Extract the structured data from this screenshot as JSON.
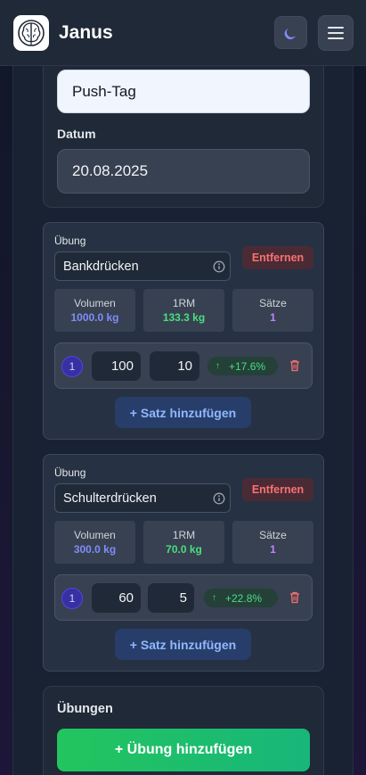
{
  "header": {
    "title": "Janus",
    "logo_icon": "brain-icon",
    "theme_icon": "moon-icon",
    "menu_icon": "hamburger-menu-icon"
  },
  "workout": {
    "name_value": "Push-Tag",
    "date_label": "Datum",
    "date_value": "20.08.2025"
  },
  "exercises": [
    {
      "label": "Übung",
      "name": "Bankdrücken",
      "remove_label": "Entfernen",
      "stats": {
        "volume_label": "Volumen",
        "volume_value": "1000.0 kg",
        "orm_label": "1RM",
        "orm_value": "133.3 kg",
        "sets_label": "Sätze",
        "sets_value": "1"
      },
      "sets": [
        {
          "number": "1",
          "weight": "100",
          "reps": "10",
          "change": "+17.6%"
        }
      ],
      "add_set_label": "+ Satz hinzufügen"
    },
    {
      "label": "Übung",
      "name": "Schulterdrücken",
      "remove_label": "Entfernen",
      "stats": {
        "volume_label": "Volumen",
        "volume_value": "300.0 kg",
        "orm_label": "1RM",
        "orm_value": "70.0 kg",
        "sets_label": "Sätze",
        "sets_value": "1"
      },
      "sets": [
        {
          "number": "1",
          "weight": "60",
          "reps": "5",
          "change": "+22.8%"
        }
      ],
      "add_set_label": "+ Satz hinzufügen"
    }
  ],
  "exercises_section": {
    "title": "Übungen",
    "add_button_label": "+ Übung hinzufügen"
  },
  "colors": {
    "volume": "#818cf8",
    "orm": "#4ade80",
    "sets": "#c084fc",
    "remove": "#f87171",
    "add_set": "#8fb8ff",
    "add_exercise_start": "#22c55e",
    "add_exercise_end": "#18b67a"
  }
}
